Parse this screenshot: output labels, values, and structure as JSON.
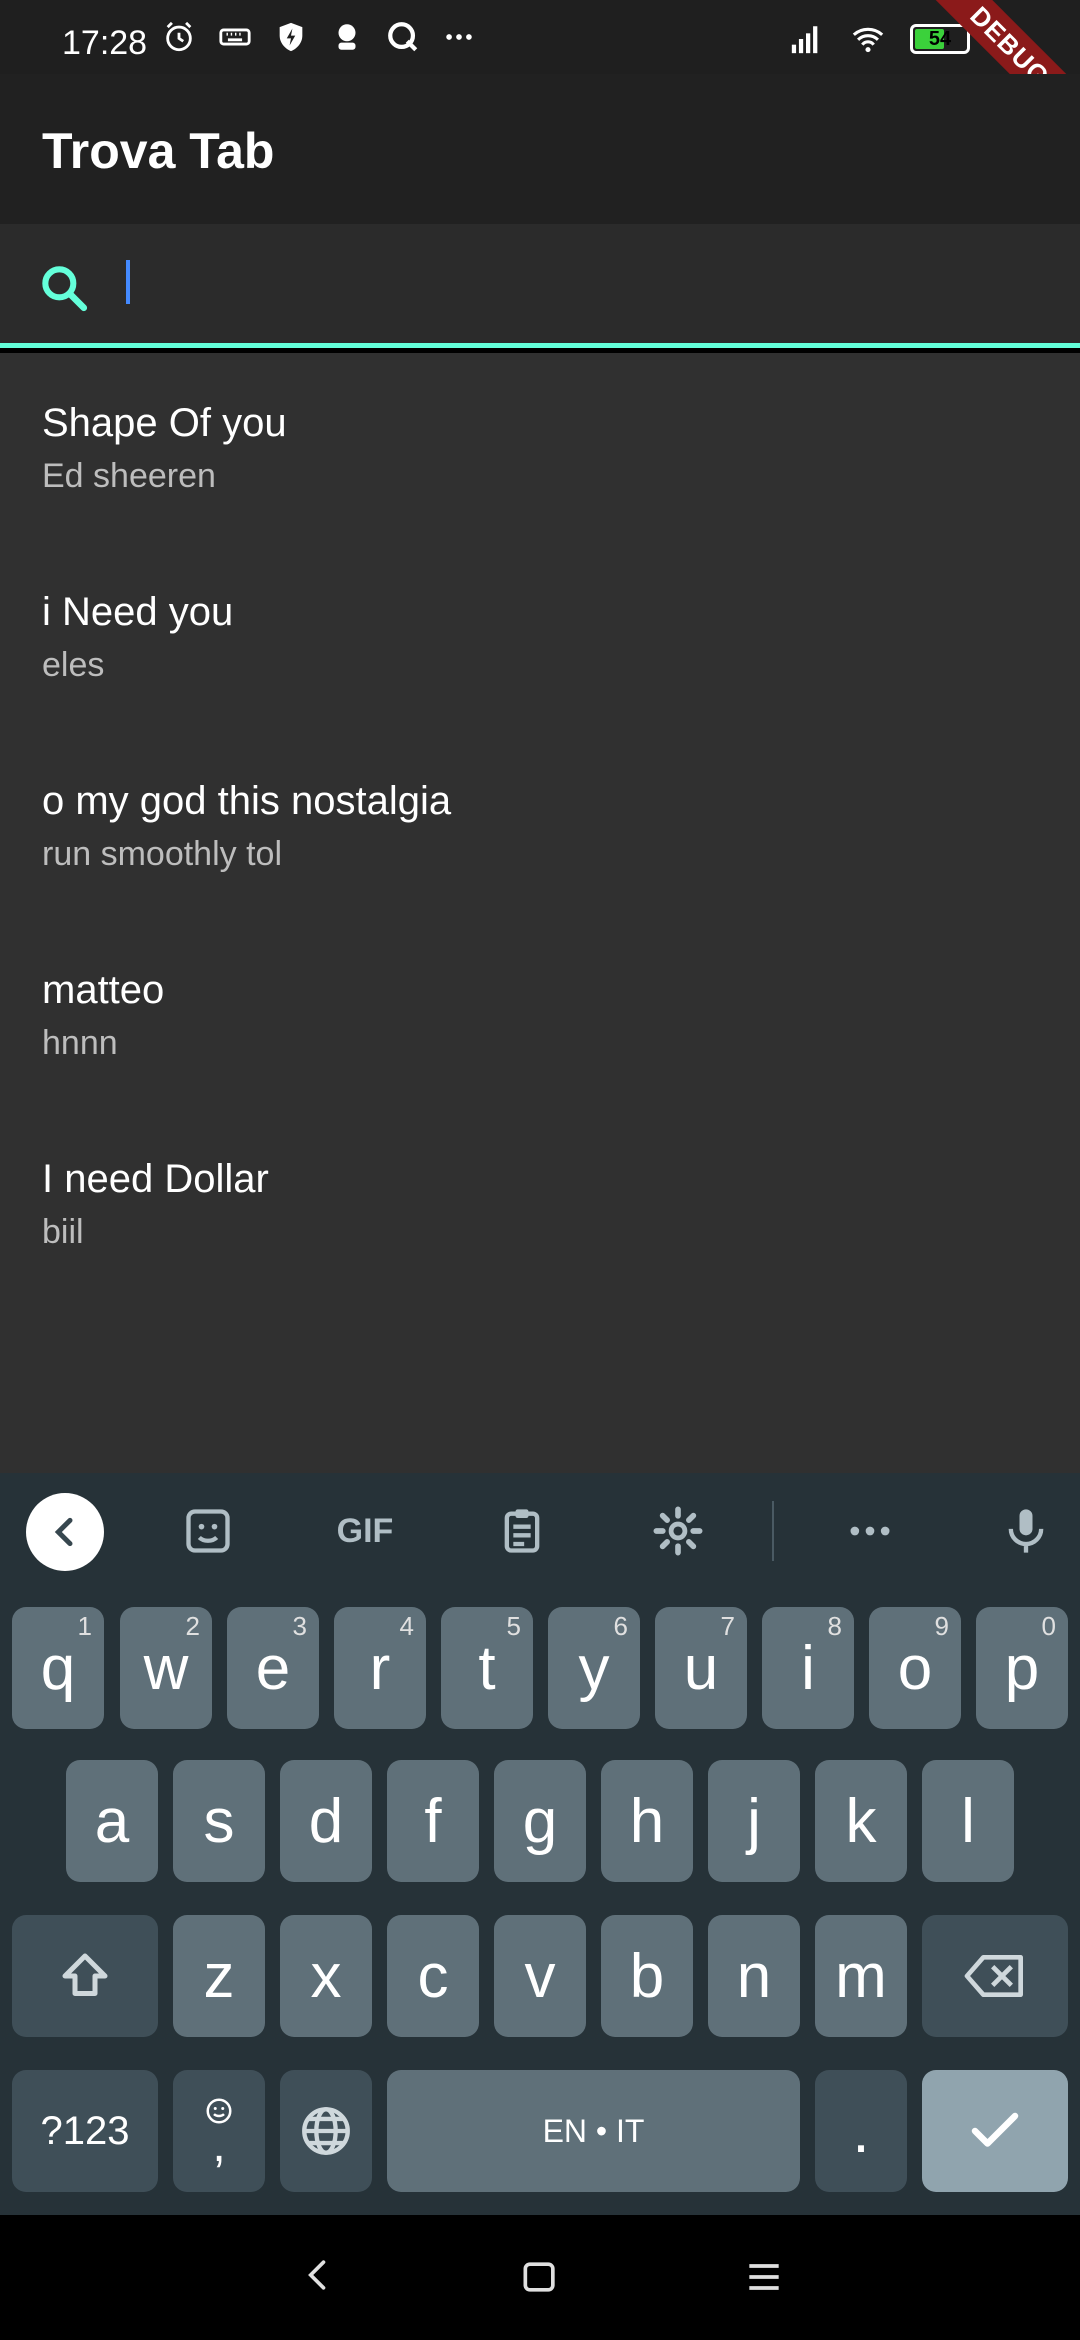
{
  "status_bar": {
    "time": "17:28",
    "battery_percent": "54",
    "debug_label": "DEBUG"
  },
  "app_bar": {
    "title": "Trova Tab"
  },
  "search": {
    "placeholder": "",
    "value": ""
  },
  "songs": [
    {
      "title": "Shape Of you",
      "artist": "Ed sheeren"
    },
    {
      "title": "i Need you",
      "artist": "eles"
    },
    {
      "title": "o my god this nostalgia",
      "artist": "run smoothly tol"
    },
    {
      "title": "matteo",
      "artist": "hnnn"
    },
    {
      "title": "I need Dollar",
      "artist": "biil"
    }
  ],
  "keyboard": {
    "toolbar": {
      "gif_label": "GIF"
    },
    "row1": [
      {
        "key": "q",
        "hint": "1"
      },
      {
        "key": "w",
        "hint": "2"
      },
      {
        "key": "e",
        "hint": "3"
      },
      {
        "key": "r",
        "hint": "4"
      },
      {
        "key": "t",
        "hint": "5"
      },
      {
        "key": "y",
        "hint": "6"
      },
      {
        "key": "u",
        "hint": "7"
      },
      {
        "key": "i",
        "hint": "8"
      },
      {
        "key": "o",
        "hint": "9"
      },
      {
        "key": "p",
        "hint": "0"
      }
    ],
    "row2": [
      "a",
      "s",
      "d",
      "f",
      "g",
      "h",
      "j",
      "k",
      "l"
    ],
    "row3": [
      "z",
      "x",
      "c",
      "v",
      "b",
      "n",
      "m"
    ],
    "symbols_label": "?123",
    "comma_label": ",",
    "space_label": "EN • IT",
    "period_label": "."
  },
  "colors": {
    "accent": "#64ffda",
    "caret": "#448aff",
    "list_bg": "#303030",
    "keyboard_bg": "#263238"
  }
}
